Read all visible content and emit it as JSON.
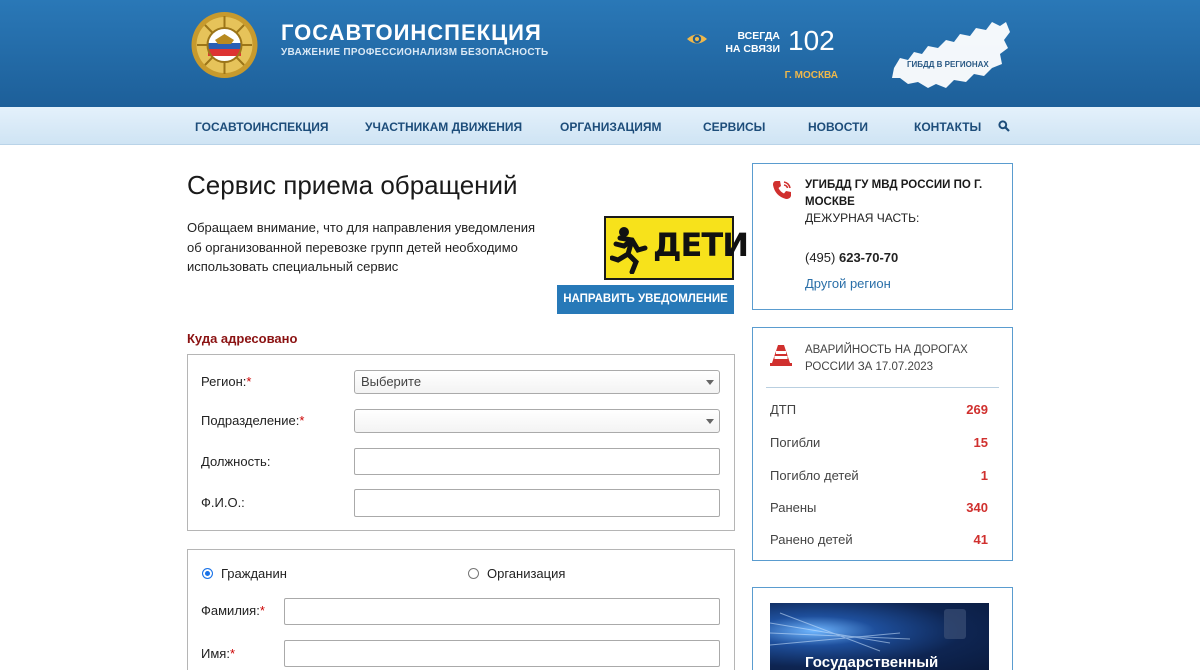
{
  "header": {
    "brand": "ГОСАВТОИНСПЕКЦИЯ",
    "slogan": "УВАЖЕНИЕ ПРОФЕССИОНАЛИЗМ БЕЗОПАСНОСТЬ",
    "always_line1": "ВСЕГДА",
    "always_line2": "НА СВЯЗИ",
    "phone": "102",
    "city": "Г. МОСКВА",
    "map_label": "ГИБДД В РЕГИОНАХ"
  },
  "nav": {
    "items": [
      "ГОСАВТОИНСПЕКЦИЯ",
      "УЧАСТНИКАМ ДВИЖЕНИЯ",
      "ОРГАНИЗАЦИЯМ",
      "СЕРВИСЫ",
      "НОВОСТИ",
      "КОНТАКТЫ"
    ],
    "search_icon": "search-icon"
  },
  "main": {
    "title": "Сервис приема обращений",
    "notice": "Обращаем внимание, что для направления уведомления об организованной перевозке групп детей необходимо использовать специальный сервис",
    "deti_label": "ДЕТИ",
    "notify_button": "НАПРАВИТЬ УВЕДОМЛЕНИЕ",
    "addressed_heading": "Куда адресовано",
    "form1": {
      "region_label": "Регион:",
      "region_value": "Выберите",
      "division_label": "Подразделение:",
      "division_value": "",
      "position_label": "Должность:",
      "fio_label": "Ф.И.О.:",
      "required_mark": "*"
    },
    "form2": {
      "citizen_label": "Гражданин",
      "org_label": "Организация",
      "surname_label": "Фамилия:",
      "name_label": "Имя:",
      "required_mark": "*"
    }
  },
  "sidebar": {
    "contact": {
      "department": "УГИБДД ГУ МВД РОССИИ ПО Г. МОСКВЕ",
      "duty_label": "ДЕЖУРНАЯ ЧАСТЬ:",
      "phone_code": "(495)",
      "phone_number": "623-70-70",
      "other_region": "Другой регион"
    },
    "accidents": {
      "title": "АВАРИЙНОСТЬ НА ДОРОГАХ РОССИИ ЗА 17.07.2023",
      "rows": [
        {
          "label": "ДТП",
          "value": "269"
        },
        {
          "label": "Погибли",
          "value": "15"
        },
        {
          "label": "Погибло детей",
          "value": "1"
        },
        {
          "label": "Ранены",
          "value": "340"
        },
        {
          "label": "Ранено детей",
          "value": "41"
        }
      ]
    },
    "banner_text": "Государственный"
  },
  "colors": {
    "header_blue": "#2a78b7",
    "nav_text": "#1d4d7a",
    "accent_red": "#d0302e",
    "button_blue": "#2779b8",
    "heading_dark_red": "#8b1212",
    "deti_yellow": "#f7e21b"
  }
}
